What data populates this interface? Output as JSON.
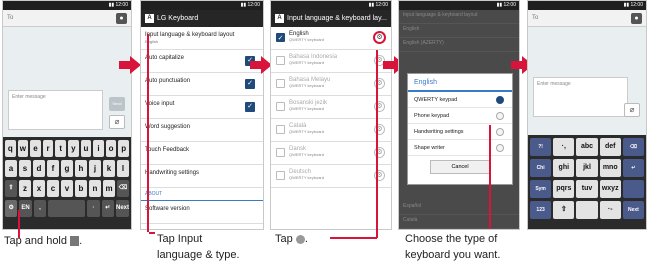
{
  "colors": {
    "accent": "#d8143a",
    "blue": "#3a7bc8",
    "navy": "#1f4a7a"
  },
  "phone1": {
    "to_placeholder": "To",
    "msg_placeholder": "Enter message",
    "send": "Send",
    "rows": [
      [
        "q",
        "w",
        "e",
        "r",
        "t",
        "y",
        "u",
        "i",
        "o",
        "p"
      ],
      [
        "a",
        "s",
        "d",
        "f",
        "g",
        "h",
        "j",
        "k",
        "l"
      ],
      [
        "⇧",
        "z",
        "x",
        "c",
        "v",
        "b",
        "n",
        "m",
        "⌫"
      ],
      [
        "⚙",
        "EN",
        ",",
        "",
        "·",
        "↵",
        "Next"
      ]
    ]
  },
  "phone2": {
    "app_title": "LG Keyboard",
    "items": [
      {
        "label": "Input language & keyboard layout",
        "sub": "English",
        "check": false
      },
      {
        "label": "Auto capitalize",
        "sub": "",
        "check": true
      },
      {
        "label": "Auto punctuation",
        "sub": "",
        "check": true
      },
      {
        "label": "Voice input",
        "sub": "",
        "check": true
      },
      {
        "label": "Word suggestion",
        "sub": "",
        "check": false
      },
      {
        "label": "Touch Feedback",
        "sub": "",
        "check": false
      },
      {
        "label": "Handwriting settings",
        "sub": "",
        "check": false
      }
    ],
    "about": "ABOUT",
    "version": "Software version"
  },
  "phone3": {
    "title": "Input language & keyboard lay...",
    "langs": [
      {
        "name": "English",
        "sub": "QWERTY keyboard",
        "on": true
      },
      {
        "name": "Bahasa Indonesia",
        "sub": "QWERTY keyboard",
        "on": false
      },
      {
        "name": "Bahasa Melayu",
        "sub": "QWERTY keyboard",
        "on": false
      },
      {
        "name": "Bosanski jezik",
        "sub": "QWERTY keyboard",
        "on": false
      },
      {
        "name": "Català",
        "sub": "QWERTY keyboard",
        "on": false
      },
      {
        "name": "Dansk",
        "sub": "QWERTY keyboard",
        "on": false
      },
      {
        "name": "Deutsch",
        "sub": "QWERTY keyboard",
        "on": false
      }
    ]
  },
  "phone4": {
    "bg_rows": [
      "Input language & keyboard layout",
      "English",
      "English (AZERTY)"
    ],
    "bottom_rows": [
      "Español",
      "Català"
    ],
    "dialog_title": "English",
    "options": [
      {
        "label": "QWERTY keypad",
        "on": true
      },
      {
        "label": "Phone keypad",
        "on": false
      },
      {
        "label": "Handwriting settings",
        "on": false
      },
      {
        "label": "Shape writer",
        "on": false
      }
    ],
    "cancel": "Cancel"
  },
  "phone5": {
    "to_placeholder": "To",
    "msg_placeholder": "Enter message",
    "rows": [
      [
        "?!",
        "·,",
        "abc",
        "def",
        "⌫"
      ],
      [
        "Chi",
        "ghi",
        "jkl",
        "mno",
        "↵"
      ],
      [
        "Sym",
        "pqrs",
        "tuv",
        "wxyz",
        ""
      ],
      [
        "123",
        "⇧",
        "",
        "·-",
        "Next"
      ]
    ]
  },
  "captions": {
    "c1": "Tap and hold",
    "c2a": "Tap Input",
    "c2b": "language & type.",
    "c3": "Tap",
    "c4a": "Choose the type of",
    "c4b": "keyboard you want."
  }
}
